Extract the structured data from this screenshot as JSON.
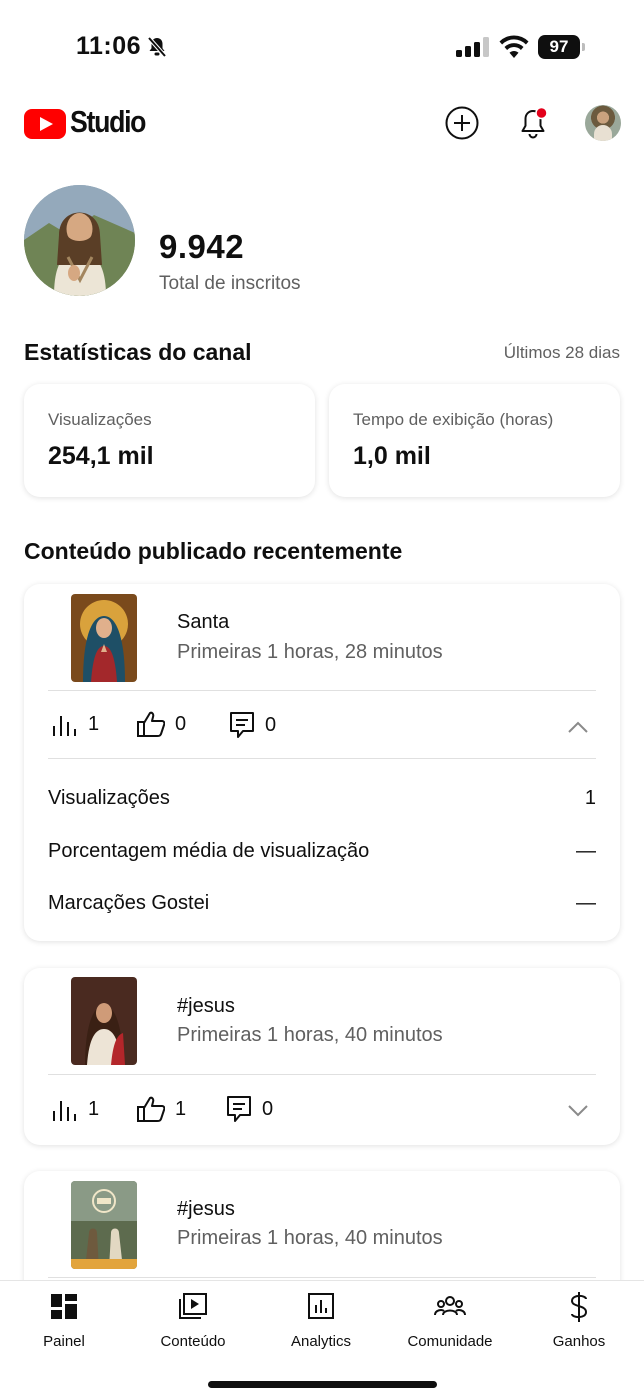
{
  "status_bar": {
    "time": "11:06",
    "battery": "97"
  },
  "header": {
    "brand": "Studio"
  },
  "channel": {
    "subscribers": "9.942",
    "subscribers_label": "Total de inscritos"
  },
  "stats": {
    "title": "Estatísticas do canal",
    "period": "Últimos 28 dias",
    "cards": [
      {
        "label": "Visualizações",
        "value": "254,1 mil"
      },
      {
        "label": "Tempo de exibição (horas)",
        "value": "1,0 mil"
      }
    ]
  },
  "recent": {
    "title": "Conteúdo publicado recentemente",
    "items": [
      {
        "title": "Santa",
        "meta": "Primeiras 1 horas, 28 minutos",
        "views": "1",
        "likes": "0",
        "comments": "0",
        "expanded": true,
        "details": [
          {
            "label": "Visualizações",
            "value": "1"
          },
          {
            "label": "Porcentagem média de visualização",
            "value": "—"
          },
          {
            "label": "Marcações Gostei",
            "value": "—"
          }
        ]
      },
      {
        "title": "#jesus",
        "meta": "Primeiras 1 horas, 40 minutos",
        "views": "1",
        "likes": "1",
        "comments": "0",
        "expanded": false
      },
      {
        "title": "#jesus",
        "meta": "Primeiras 1 horas, 40 minutos"
      }
    ]
  },
  "nav": {
    "items": [
      {
        "label": "Painel",
        "icon": "dashboard-icon"
      },
      {
        "label": "Conteúdo",
        "icon": "content-icon"
      },
      {
        "label": "Analytics",
        "icon": "analytics-icon"
      },
      {
        "label": "Comunidade",
        "icon": "community-icon"
      },
      {
        "label": "Ganhos",
        "icon": "earn-icon"
      }
    ]
  },
  "colors": {
    "brand_red": "#ff0000",
    "notification_dot": "#e3001b",
    "text_secondary": "#606060"
  }
}
